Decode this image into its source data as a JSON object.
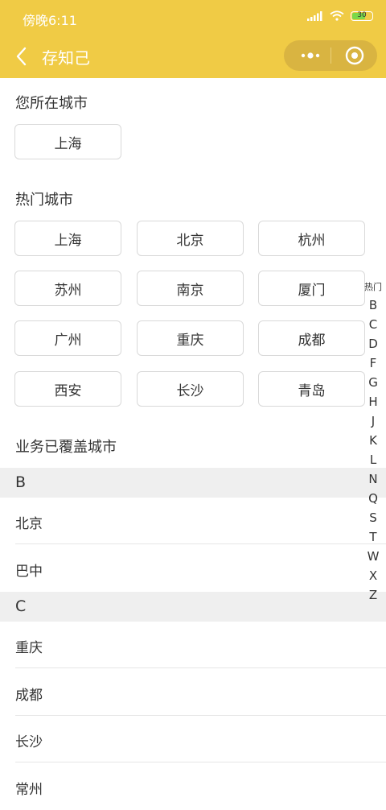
{
  "status": {
    "time": "傍晚6:11",
    "battery": "30"
  },
  "nav": {
    "title": "存知己",
    "more_icon": "more-dots-icon",
    "target_icon": "target-circle-icon"
  },
  "current_city": {
    "title": "您所在城市",
    "city": "上海"
  },
  "hot_cities": {
    "title": "热门城市",
    "items": [
      "上海",
      "北京",
      "杭州",
      "苏州",
      "南京",
      "厦门",
      "广州",
      "重庆",
      "成都",
      "西安",
      "长沙",
      "青岛"
    ]
  },
  "covered": {
    "title": "业务已覆盖城市"
  },
  "groups": [
    {
      "letter": "B",
      "cities": [
        "北京",
        "巴中"
      ]
    },
    {
      "letter": "C",
      "cities": [
        "重庆",
        "成都",
        "长沙",
        "常州"
      ]
    }
  ],
  "index": {
    "hot": "热门",
    "letters": [
      "B",
      "C",
      "D",
      "F",
      "G",
      "H",
      "J",
      "K",
      "L",
      "N",
      "Q",
      "S",
      "T",
      "W",
      "X",
      "Z"
    ]
  },
  "colors": {
    "header": "#F0CB45",
    "capsule": "#D9B441",
    "battery_fill": "#7BD84A"
  }
}
